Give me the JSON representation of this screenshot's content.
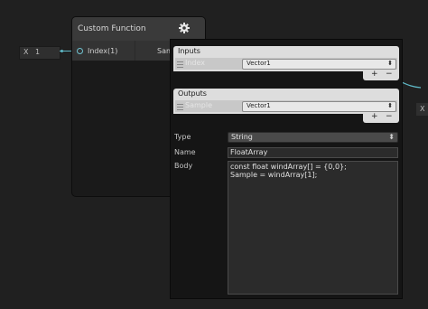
{
  "left_input": {
    "axis": "X",
    "value": "1"
  },
  "right_input": {
    "axis": "X"
  },
  "node": {
    "title": "Custom Function",
    "input_port": "Index(1)",
    "output_port": "Samp",
    "gear_icon": "gear-icon"
  },
  "panel": {
    "inputs": {
      "header": "Inputs",
      "rows": [
        {
          "name": "Index",
          "type": "Vector1"
        }
      ],
      "add": "+",
      "remove": "−"
    },
    "outputs": {
      "header": "Outputs",
      "rows": [
        {
          "name": "Sample",
          "type": "Vector1"
        }
      ],
      "add": "+",
      "remove": "−"
    },
    "type": {
      "label": "Type",
      "value": "String"
    },
    "name": {
      "label": "Name",
      "value": "FloatArray"
    },
    "body": {
      "label": "Body",
      "lines": [
        "const float windArray[] = {0,0};",
        "Sample = windArray[1];"
      ]
    }
  },
  "colors": {
    "wire": "#5fb9c7",
    "section_header": "#dddddd"
  },
  "icons": {
    "dropdown_arrow": "updown-arrow-icon"
  }
}
